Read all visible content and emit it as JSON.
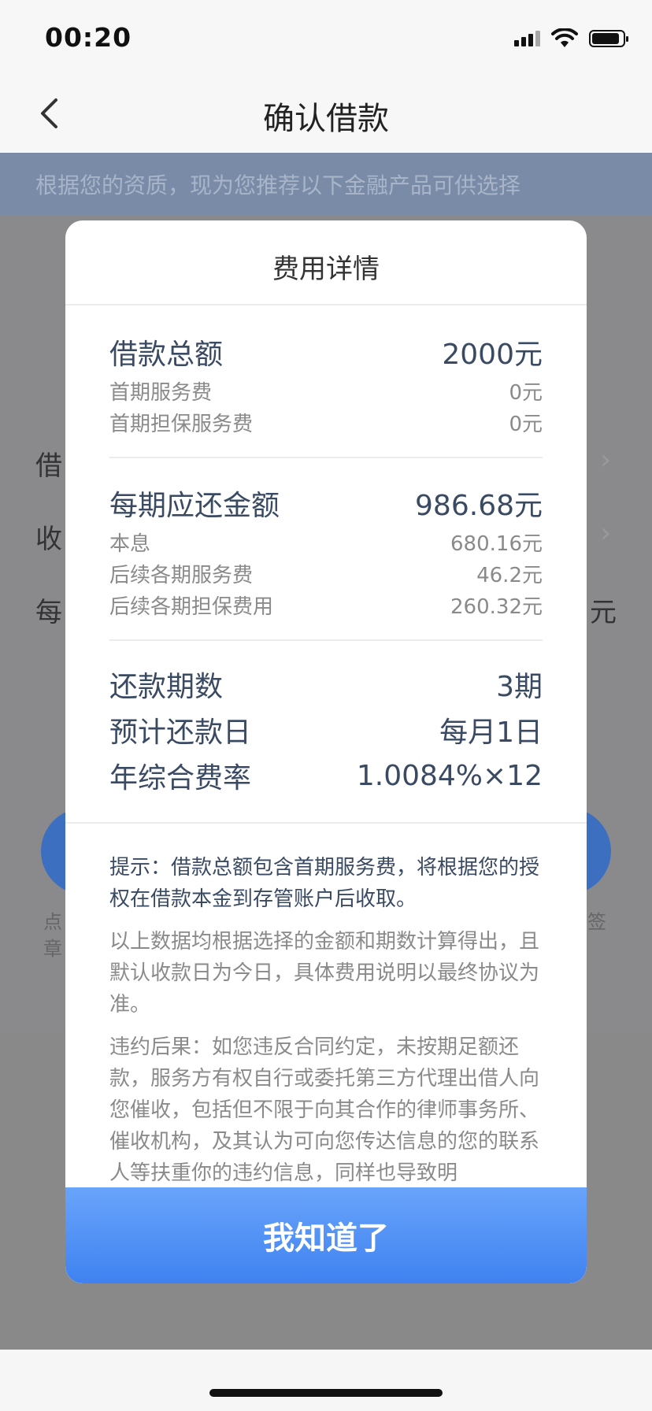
{
  "status_bar": {
    "time": "00:20"
  },
  "nav": {
    "title": "确认借款"
  },
  "banner": {
    "text": "根据您的资质，现为您推荐以下金融产品可供选择"
  },
  "background": {
    "row1_label": "借",
    "row2_label": "收",
    "row3_label": "每",
    "row3_value": "元",
    "left_small_text": "点\n章",
    "right_small_text": "签"
  },
  "modal": {
    "title": "费用详情",
    "section1": {
      "major_label": "借款总额",
      "major_value": "2000元",
      "items": [
        {
          "label": "首期服务费",
          "value": "0元"
        },
        {
          "label": "首期担保服务费",
          "value": "0元"
        }
      ]
    },
    "section2": {
      "major_label": "每期应还金额",
      "major_value": "986.68元",
      "items": [
        {
          "label": "本息",
          "value": "680.16元"
        },
        {
          "label": "后续各期服务费",
          "value": "46.2元"
        },
        {
          "label": "后续各期担保费用",
          "value": "260.32元"
        }
      ]
    },
    "section3": {
      "items": [
        {
          "label": "还款期数",
          "value": "3期"
        },
        {
          "label": "预计还款日",
          "value": "每月1日"
        },
        {
          "label": "年综合费率",
          "value": "1.0084%×12"
        }
      ]
    },
    "notes": {
      "hint": "提示：借款总额包含首期服务费，将根据您的授权在借款本金到存管账户后收取。",
      "calc": "以上数据均根据选择的金额和期数计算得出，且默认收款日为今日，具体费用说明以最终协议为准。",
      "breach": "违约后果：如您违反合同约定，未按期足额还款，服务方有权自行或委托第三方代理出借人向您催收，包括但不限于向其合作的律师事务所、催收机构，及其认为可向您传达信息的您的联系人等扶重你的违约信息，同样也导致明"
    },
    "button_label": "我知道了"
  }
}
